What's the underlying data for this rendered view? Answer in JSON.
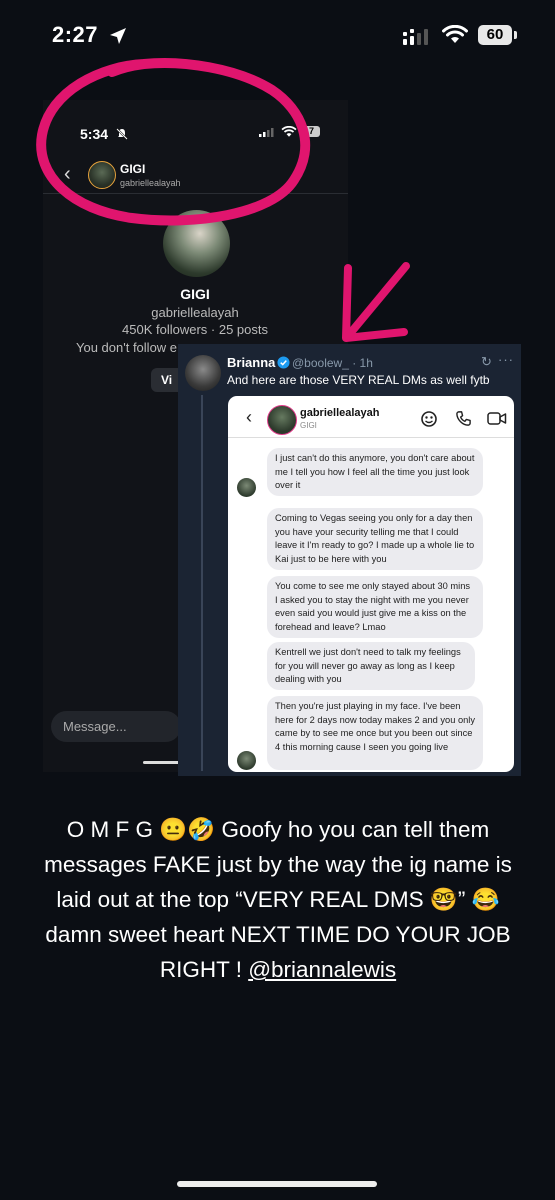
{
  "status_bar": {
    "time": "2:27",
    "battery": "60"
  },
  "inner_screenshot": {
    "status_time": "5:34",
    "battery": "7",
    "header_name": "GIGI",
    "header_handle": "gabriellealayah",
    "profile_name": "GIGI",
    "profile_handle": "gabriellealayah",
    "profile_stats": "450K followers · 25 posts",
    "follow_text": "You don't follow e",
    "view_button": "Vi",
    "message_placeholder": "Message..."
  },
  "tweet": {
    "name": "Brianna",
    "handle": "@boolew_ · 1h",
    "text": "And here are those VERY REAL DMs as well fytb",
    "dm": {
      "name": "gabriellealayah",
      "subtitle": "GIGI",
      "messages": [
        "I just can't do this anymore, you don't care about me I tell you how I feel all the time you just look over it",
        "Coming to Vegas seeing you only for a day then you have your security telling me that I could leave it I'm ready to go? I made up a whole lie to Kai just to be here with you",
        "You come to see me only stayed about 30 mins I asked you to stay the night with me you never even said you would just give me a kiss on the forehead and leave? Lmao",
        "Kentrell we just don't need to talk my feelings for you will never go away as long as I keep dealing with you",
        "Then you're just playing in my face. I've been here for 2 days now today makes 2 and you only came by to see me once but you been out since 4 this morning cause I seen you going live"
      ]
    }
  },
  "caption": {
    "text": "O M F G 😐🤣  Goofy ho you can tell them messages FAKE  just by the way the ig name is laid out at the top “VERY REAL DMS 🤓” 😂 damn sweet heart  NEXT TIME DO YOUR JOB RIGHT ! ",
    "mention": "@briannalewis"
  },
  "colors": {
    "highlight_pink": "#e0156e",
    "background": "#0b0e14",
    "tweet_bg": "#1b2433",
    "verified_blue": "#1d9bf0"
  },
  "icons": [
    "location-arrow-icon",
    "signal-icon",
    "wifi-icon",
    "battery-icon",
    "back-chevron-icon",
    "verified-icon",
    "refresh-icon",
    "more-icon",
    "sticker-icon",
    "phone-icon",
    "video-icon"
  ]
}
